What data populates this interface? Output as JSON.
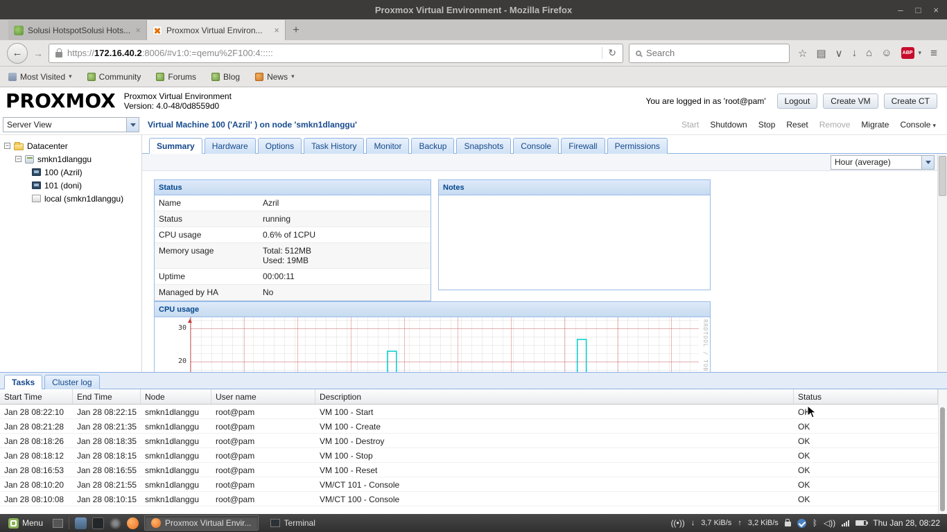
{
  "colors": {
    "proxmox_tab_blue": "#15498B",
    "panel_border": "#99bbe8",
    "panel_header_text": "#04468C",
    "spike_cyan": "#00cccc",
    "abp_red": "#c70d2c",
    "mint_green": "#8bb158",
    "firefox_orange": "#e8702a"
  },
  "window": {
    "title": "Proxmox Virtual Environment - Mozilla Firefox",
    "controls": {
      "minimize": "–",
      "maximize": "□",
      "close": "×"
    }
  },
  "browser": {
    "tabs": [
      {
        "title": "Solusi HotspotSolusi Hots...",
        "close": "×"
      },
      {
        "title": "Proxmox Virtual Environ...",
        "close": "×"
      }
    ],
    "new_tab": "+",
    "nav": {
      "back": "←",
      "forward": "→",
      "reload": "↻"
    },
    "url": {
      "scheme": "https://",
      "host": "172.16.40.2",
      "rest": ":8006/#v1:0:=qemu%2F100:4:::::"
    },
    "search_placeholder": "Search",
    "icons": {
      "star": "☆",
      "bookmarks": "▤",
      "pocket": "∨",
      "download": "↓",
      "home": "⌂",
      "chat": "☺",
      "abp": "ABP",
      "caret": "▾",
      "menu": "≡"
    },
    "bookmarks": [
      {
        "label": "Most Visited",
        "caret": "▾"
      },
      {
        "label": "Community"
      },
      {
        "label": "Forums"
      },
      {
        "label": "Blog"
      },
      {
        "label": "News",
        "caret": "▾"
      }
    ]
  },
  "proxmox": {
    "logo": "PROXMOX",
    "product": "Proxmox Virtual Environment",
    "version": "Version: 4.0-48/0d8559d0",
    "login_status": "You are logged in as 'root@pam'",
    "buttons": {
      "logout": "Logout",
      "create_vm": "Create VM",
      "create_ct": "Create CT"
    },
    "view_selector": "Server View",
    "breadcrumb": "Virtual Machine 100 ('Azril' ) on node 'smkn1dlanggu'",
    "vm_actions": [
      "Start",
      "Shutdown",
      "Stop",
      "Reset",
      "Remove",
      "Migrate",
      "Console"
    ],
    "console_caret": "▾",
    "expander": "−",
    "tree": [
      {
        "label": "Datacenter"
      },
      {
        "label": "smkn1dlanggu"
      },
      {
        "label": "100 (Azril)"
      },
      {
        "label": "101 (doni)"
      },
      {
        "label": "local (smkn1dlanggu)"
      }
    ],
    "tabs": [
      "Summary",
      "Hardware",
      "Options",
      "Task History",
      "Monitor",
      "Backup",
      "Snapshots",
      "Console",
      "Firewall",
      "Permissions"
    ],
    "time_selector": "Hour (average)",
    "status_panel": {
      "title": "Status",
      "rows": [
        {
          "label": "Name",
          "value": "Azril"
        },
        {
          "label": "Status",
          "value": "running"
        },
        {
          "label": "CPU usage",
          "value": "0.6% of 1CPU"
        },
        {
          "label": "Memory usage",
          "value": "Total: 512MB",
          "value2": "Used: 19MB"
        },
        {
          "label": "Uptime",
          "value": "00:00:11"
        },
        {
          "label": "Managed by HA",
          "value": "No"
        }
      ]
    },
    "notes_panel": {
      "title": "Notes"
    },
    "cpu_panel": {
      "title": "CPU usage",
      "y_ticks": [
        "30",
        "20"
      ],
      "watermark": "RRDTOOL / TOBI OETIKER"
    },
    "tasks_panel": {
      "tabs": [
        "Tasks",
        "Cluster log"
      ],
      "columns": [
        "Start Time",
        "End Time",
        "Node",
        "User name",
        "Description",
        "Status"
      ],
      "rows": [
        [
          "Jan 28 08:22:10",
          "Jan 28 08:22:15",
          "smkn1dlanggu",
          "root@pam",
          "VM 100 - Start",
          "OK"
        ],
        [
          "Jan 28 08:21:28",
          "Jan 28 08:21:35",
          "smkn1dlanggu",
          "root@pam",
          "VM 100 - Create",
          "OK"
        ],
        [
          "Jan 28 08:18:26",
          "Jan 28 08:18:35",
          "smkn1dlanggu",
          "root@pam",
          "VM 100 - Destroy",
          "OK"
        ],
        [
          "Jan 28 08:18:12",
          "Jan 28 08:18:15",
          "smkn1dlanggu",
          "root@pam",
          "VM 100 - Stop",
          "OK"
        ],
        [
          "Jan 28 08:16:53",
          "Jan 28 08:16:55",
          "smkn1dlanggu",
          "root@pam",
          "VM 100 - Reset",
          "OK"
        ],
        [
          "Jan 28 08:10:20",
          "Jan 28 08:21:55",
          "smkn1dlanggu",
          "root@pam",
          "VM/CT 101 - Console",
          "OK"
        ],
        [
          "Jan 28 08:10:08",
          "Jan 28 08:10:15",
          "smkn1dlanggu",
          "root@pam",
          "VM/CT 100 - Console",
          "OK"
        ]
      ]
    }
  },
  "taskbar": {
    "menu_label": "Menu",
    "windows": [
      "Proxmox Virtual Envir...",
      "Terminal"
    ],
    "tray": {
      "network": "((•))",
      "down_arrow": "↓",
      "down_speed": "3,7 KiB/s",
      "up_arrow": "↑",
      "up_speed": "3,2 KiB/s",
      "bluetooth": "ᛒ",
      "volume": "◁))"
    },
    "clock": "Thu Jan 28, 08:22"
  }
}
